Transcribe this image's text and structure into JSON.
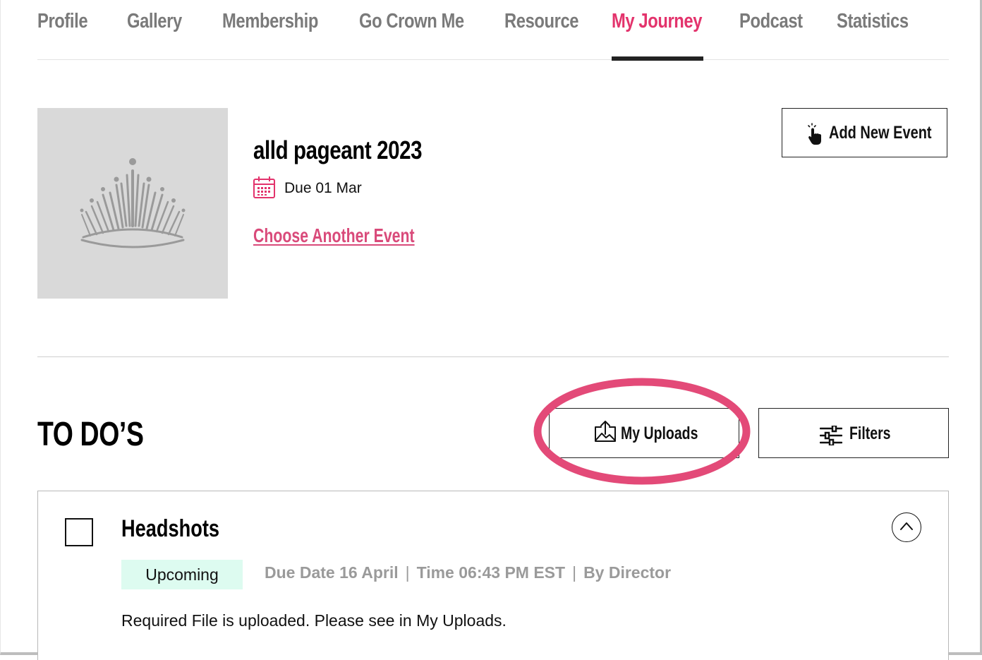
{
  "tabs": [
    {
      "label": "Profile",
      "active": false
    },
    {
      "label": "Gallery",
      "active": false
    },
    {
      "label": "Membership",
      "active": false
    },
    {
      "label": "Go Crown Me",
      "active": false
    },
    {
      "label": "Resource",
      "active": false
    },
    {
      "label": "My Journey",
      "active": true
    },
    {
      "label": "Podcast",
      "active": false
    },
    {
      "label": "Statistics",
      "active": false
    }
  ],
  "event": {
    "image_icon": "crown-icon",
    "title": "alld pageant 2023",
    "due_icon": "calendar-icon",
    "due": "Due 01 Mar",
    "choose_link": "Choose Another Event"
  },
  "actions": {
    "add_event": {
      "label": "Add New Event",
      "icon": "tap-hand-icon"
    }
  },
  "todos": {
    "title": "TO DO’S",
    "uploads_button": {
      "label": "My Uploads",
      "icon": "upload-image-icon"
    },
    "filters_button": {
      "label": "Filters",
      "icon": "sliders-icon"
    },
    "items": [
      {
        "name": "Headshots",
        "status": "Upcoming",
        "due_date": "Due Date 16 April",
        "time": "Time 06:43 PM EST",
        "by": "By Director",
        "note": "Required File is uploaded. Please see in My Uploads.",
        "expanded_icon": "chevron-up-icon"
      }
    ]
  },
  "colors": {
    "accent": "#e3336c",
    "link": "#d94a7a",
    "tab_inactive": "#7a7a7a",
    "badge_bg": "#ddfbf0",
    "annotation_circle": "#e34a78"
  }
}
